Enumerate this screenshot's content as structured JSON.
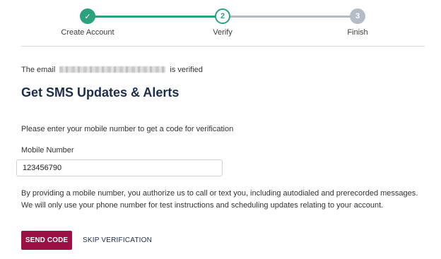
{
  "stepper": {
    "steps": [
      {
        "label": "Create Account",
        "marker": "✓",
        "state": "complete"
      },
      {
        "label": "Verify",
        "marker": "2",
        "state": "current"
      },
      {
        "label": "Finish",
        "marker": "3",
        "state": "upcoming"
      }
    ],
    "colors": {
      "complete": "#2aa37b",
      "upcoming": "#b5bcc6"
    }
  },
  "verification": {
    "prefix": "The email",
    "suffix": "is verified"
  },
  "title": "Get SMS Updates & Alerts",
  "instructions": "Please enter your mobile number to get a code for verification",
  "mobile": {
    "label": "Mobile Number",
    "value": "123456790"
  },
  "disclaimer": "By providing a mobile number, you authorize us to call or text you, including autodialed and prerecorded messages. We will only use your phone number for test instructions and scheduling updates relating to your account.",
  "actions": {
    "send_code": "SEND CODE",
    "skip": "SKIP VERIFICATION"
  },
  "colors": {
    "primary_button": "#9d1046",
    "title": "#1c2e4a"
  }
}
